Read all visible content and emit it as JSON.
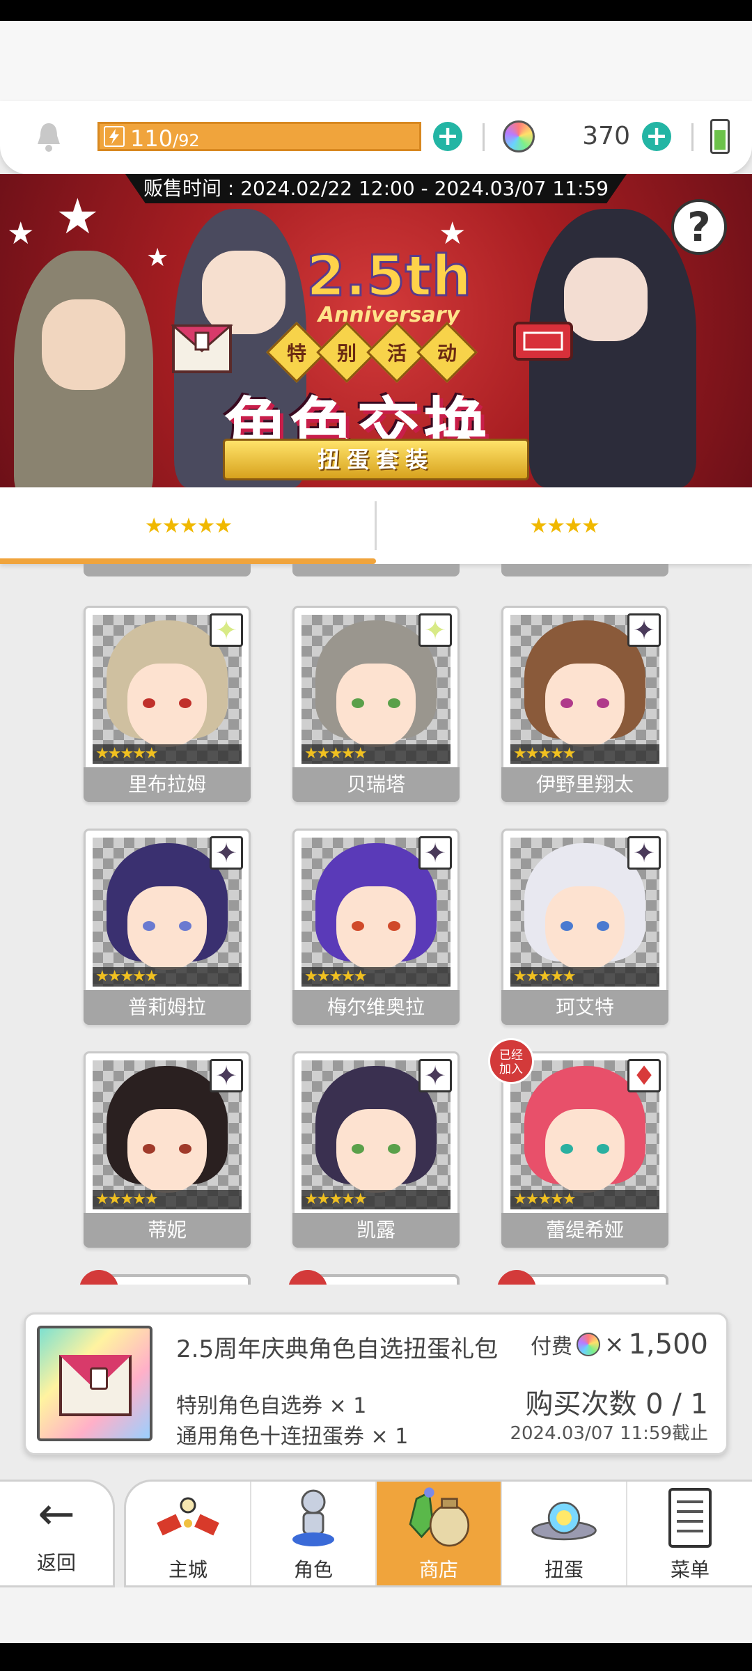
{
  "resources": {
    "stamina_current": "110",
    "stamina_max": "/92",
    "gem_count": "370"
  },
  "banner": {
    "sale_time": "贩售时间 : 2024.02/22 12:00 - 2024.03/07 11:59",
    "help_label": "?",
    "anniversary_number": "2.5th",
    "anniversary_word": "Anniversary",
    "event_tags": [
      "特",
      "别",
      "活",
      "动"
    ],
    "title": "角色交换",
    "subtitle": "扭蛋套装"
  },
  "tabs": [
    {
      "label": "★★★★★",
      "active": true
    },
    {
      "label": "★★★★",
      "active": false
    }
  ],
  "characters": [
    {
      "name": "里布拉姆",
      "rarity": "★★★★★",
      "mark": "✦",
      "mark_color": "#d8ea86",
      "hair": "#cfc0a0",
      "eye": "#c0302a",
      "added": false
    },
    {
      "name": "贝瑞塔",
      "rarity": "★★★★★",
      "mark": "✦",
      "mark_color": "#d8ea86",
      "hair": "#9a968e",
      "eye": "#5aa04a",
      "added": false
    },
    {
      "name": "伊野里翔太",
      "rarity": "★★★★★",
      "mark": "✦",
      "mark_color": "#4a3a5a",
      "hair": "#8a5a3a",
      "eye": "#b03a8a",
      "added": false
    },
    {
      "name": "普莉姆拉",
      "rarity": "★★★★★",
      "mark": "✦",
      "mark_color": "#4a3a5a",
      "hair": "#3a3070",
      "eye": "#6a7ad0",
      "added": false
    },
    {
      "name": "梅尔维奥拉",
      "rarity": "★★★★★",
      "mark": "✦",
      "mark_color": "#4a3a5a",
      "hair": "#5a3ab8",
      "eye": "#d04a2a",
      "added": false
    },
    {
      "name": "珂艾特",
      "rarity": "★★★★★",
      "mark": "✦",
      "mark_color": "#4a3a5a",
      "hair": "#e8e8f0",
      "eye": "#4a7ad0",
      "added": false
    },
    {
      "name": "蒂妮",
      "rarity": "★★★★★",
      "mark": "✦",
      "mark_color": "#4a3a5a",
      "hair": "#2a2020",
      "eye": "#a03a2a",
      "added": false
    },
    {
      "name": "凯露",
      "rarity": "★★★★★",
      "mark": "✦",
      "mark_color": "#4a3a5a",
      "hair": "#3a3050",
      "eye": "#5aa04a",
      "added": false
    },
    {
      "name": "蕾缇希娅",
      "rarity": "★★★★★",
      "mark": "♦",
      "mark_color": "#d83a3a",
      "hair": "#e8506a",
      "eye": "#2ab0a0",
      "added": true
    }
  ],
  "added_badge": "已经\n加入",
  "package": {
    "title": "2.5周年庆典角色自选扭蛋礼包",
    "price_label": "付费",
    "times_symbol": "×",
    "price_amount": "1,500",
    "item1": "特别角色自选券 × 1",
    "item2": "通用角色十连扭蛋券 × 1",
    "purchase_limit": "购买次数 0 / 1",
    "deadline": "2024.03/07 11:59截止"
  },
  "nav": {
    "back": "返回",
    "items": [
      "主城",
      "角色",
      "商店",
      "扭蛋",
      "菜单"
    ],
    "active_index": 2
  },
  "colors": {
    "accent": "#f0a43c",
    "teal": "#23b5a4",
    "badge_red": "#d33a3a"
  }
}
